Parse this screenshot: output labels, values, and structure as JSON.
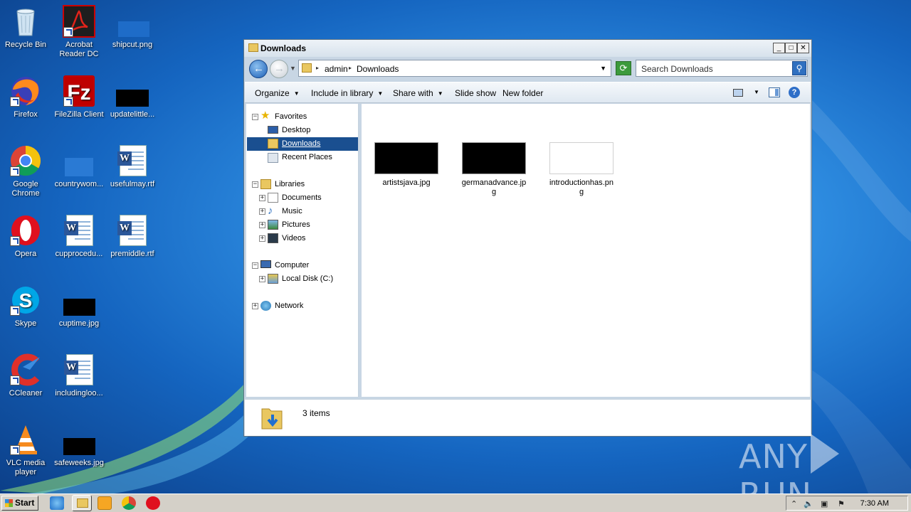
{
  "desktop": {
    "icons": [
      {
        "label": "Recycle Bin"
      },
      {
        "label": "Acrobat Reader DC"
      },
      {
        "label": "shipcut.png"
      },
      {
        "label": "Firefox"
      },
      {
        "label": "FileZilla Client"
      },
      {
        "label": "updatelittle..."
      },
      {
        "label": "Google Chrome"
      },
      {
        "label": "countrywom..."
      },
      {
        "label": "usefulmay.rtf"
      },
      {
        "label": "Opera"
      },
      {
        "label": "cupprocedu..."
      },
      {
        "label": "premiddle.rtf"
      },
      {
        "label": "Skype"
      },
      {
        "label": "cuptime.jpg"
      },
      {
        "label": "CCleaner"
      },
      {
        "label": "includingloo..."
      },
      {
        "label": "VLC media player"
      },
      {
        "label": "safeweeks.jpg"
      }
    ]
  },
  "window": {
    "title": "Downloads",
    "caption_buttons": {
      "minimize": "_",
      "maximize": "□",
      "close": "✕"
    },
    "address": {
      "crumbs": [
        "admin",
        "Downloads"
      ]
    },
    "search": {
      "placeholder": "Search Downloads"
    },
    "toolbar": {
      "organize": "Organize",
      "include_in_library": "Include in library",
      "share_with": "Share with",
      "slide_show": "Slide show",
      "new_folder": "New folder"
    },
    "nav": {
      "favorites": "Favorites",
      "desktop": "Desktop",
      "downloads": "Downloads",
      "recent_places": "Recent Places",
      "libraries": "Libraries",
      "documents": "Documents",
      "music": "Music",
      "pictures": "Pictures",
      "videos": "Videos",
      "computer": "Computer",
      "local_disk": "Local Disk (C:)",
      "network": "Network"
    },
    "files": [
      {
        "name": "artistsjava.jpg",
        "thumb": "black"
      },
      {
        "name": "germanadvance.jpg",
        "thumb": "black"
      },
      {
        "name": "introductionhas.png",
        "thumb": "white"
      }
    ],
    "status": {
      "item_count": "3 items"
    }
  },
  "taskbar": {
    "start_label": "Start",
    "clock": "7:30 AM"
  },
  "watermark": {
    "left": "ANY",
    "right": "RUN"
  }
}
